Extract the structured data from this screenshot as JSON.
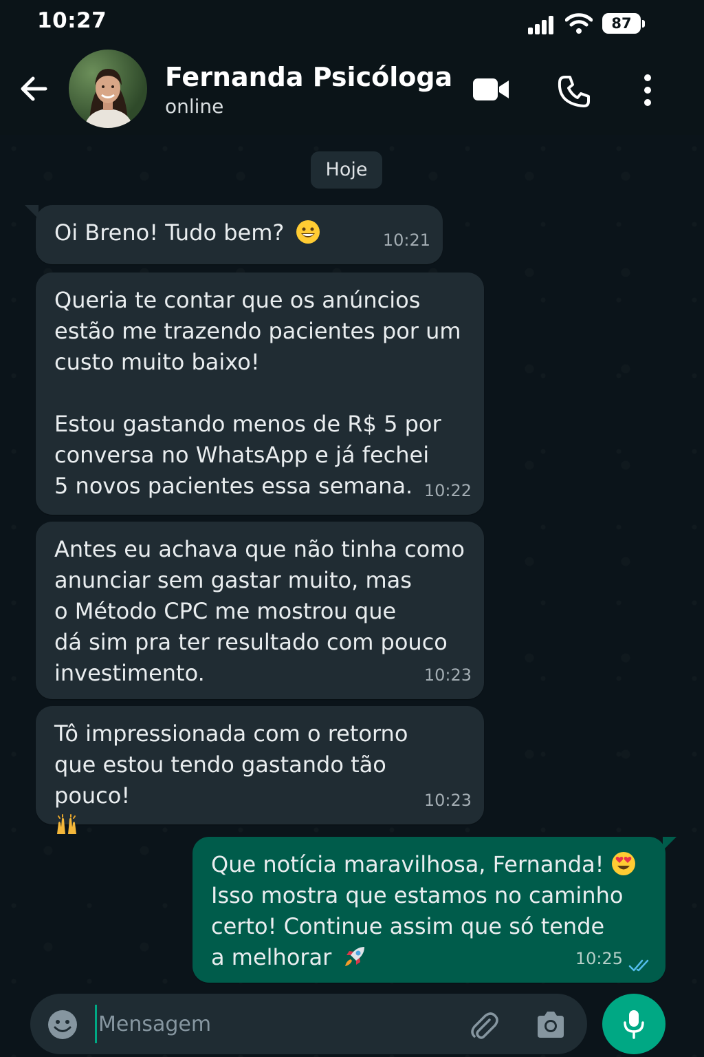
{
  "status_bar": {
    "time": "10:27",
    "battery": "87"
  },
  "header": {
    "contact_name": "Fernanda Psicóloga",
    "contact_status": "online",
    "icons": [
      "back-arrow-icon",
      "video-call-icon",
      "phone-icon",
      "more-vertical-icon"
    ]
  },
  "chat": {
    "date_label": "Hoje",
    "messages": [
      {
        "direction": "in",
        "text": "Oi Breno! Tudo bem?",
        "emoji": "grinning-face",
        "time": "10:21"
      },
      {
        "direction": "in",
        "text": "Queria te contar que os anúncios\nestão me trazendo pacientes por um\ncusto muito baixo!\n\nEstou gastando menos de R$ 5 por\nconversa no WhatsApp e já fechei\n5 novos pacientes essa semana.",
        "time": "10:22"
      },
      {
        "direction": "in",
        "text": "Antes eu achava que não tinha como\nanunciar sem gastar muito, mas\no Método CPC me mostrou que\ndá sim pra ter resultado com pouco\ninvestimento.",
        "time": "10:23"
      },
      {
        "direction": "in",
        "text": "Tô impressionada com o retorno\nque estou tendo gastando tão pouco!",
        "emoji": "raising-hands",
        "time": "10:23"
      },
      {
        "direction": "out",
        "text_line1": "Que notícia maravilhosa, Fernanda!",
        "text_rest": "Isso mostra que estamos no caminho\ncerto! Continue assim que só tende\na melhorar",
        "emoji1": "heart-eyes",
        "emoji2": "rocket",
        "time": "10:25",
        "status": "read"
      }
    ]
  },
  "input": {
    "placeholder": "Mensagem",
    "value": ""
  },
  "colors": {
    "background": "#0b141a",
    "incoming_bubble": "#202c33",
    "outgoing_bubble": "#005c4b",
    "accent": "#00a884",
    "read_ticks": "#53bdeb"
  }
}
